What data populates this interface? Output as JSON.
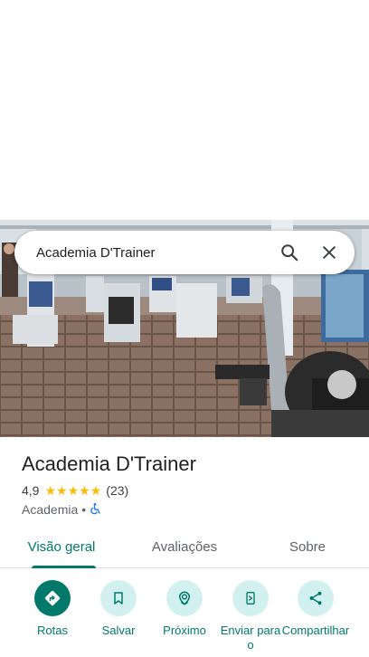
{
  "search": {
    "value": "Academia D'Trainer"
  },
  "place": {
    "name": "Academia D'Trainer",
    "rating": "4,9",
    "stars": 5,
    "review_count": "(23)",
    "category": "Academia",
    "separator": "•"
  },
  "tabs": [
    {
      "label": "Visão geral",
      "active": true
    },
    {
      "label": "Avaliações",
      "active": false
    },
    {
      "label": "Sobre",
      "active": false
    }
  ],
  "actions": [
    {
      "label": "Rotas",
      "icon": "directions-icon"
    },
    {
      "label": "Salvar",
      "icon": "bookmark-icon"
    },
    {
      "label": "Próximo",
      "icon": "nearby-icon"
    },
    {
      "label": "Enviar para o",
      "icon": "send-to-phone-icon"
    },
    {
      "label": "Compartilhar",
      "icon": "share-icon"
    }
  ],
  "colors": {
    "accent": "#00796b",
    "action_bg": "#d2f0ef",
    "star": "#fbbc04",
    "accessibility": "#1a73e8"
  }
}
